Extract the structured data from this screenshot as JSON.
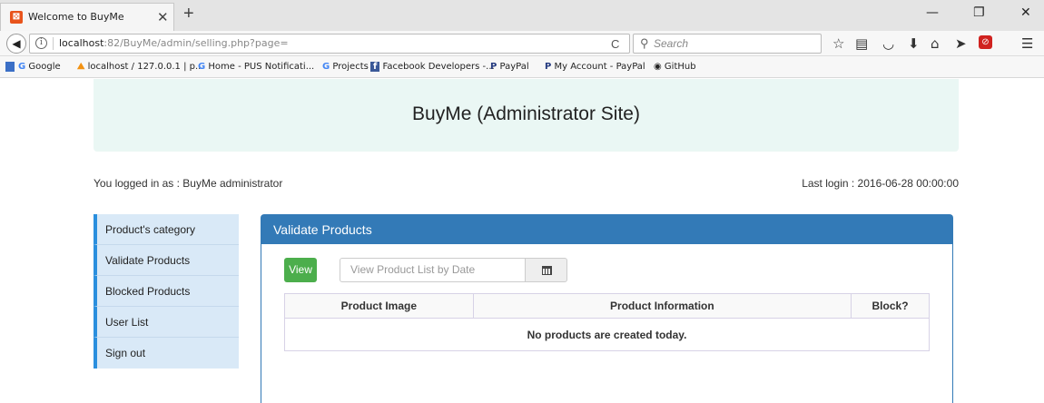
{
  "browser": {
    "tab_title": "Welcome to BuyMe",
    "tab_close": "✕",
    "new_tab": "+",
    "url_host": "localhost",
    "url_rest": ":82/BuyMe/admin/selling.php?page=",
    "search_placeholder": "Search",
    "window_controls": {
      "minimize": "—",
      "maximize": "❐",
      "close": "✕"
    },
    "bookmarks": [
      {
        "icon": "G",
        "label": "Google"
      },
      {
        "icon": "⛰",
        "label": "localhost / 127.0.0.1 | p..."
      },
      {
        "icon": "G",
        "label": "Home - PUS Notificati..."
      },
      {
        "icon": "G",
        "label": "Projects"
      },
      {
        "icon": "f",
        "label": "Facebook Developers -..."
      },
      {
        "icon": "P",
        "label": "PayPal"
      },
      {
        "icon": "P",
        "label": "My Account - PayPal"
      },
      {
        "icon": "◉",
        "label": "GitHub"
      }
    ]
  },
  "header": {
    "title": "BuyMe (Administrator Site)",
    "logged_in_as": "You logged in as : BuyMe administrator",
    "last_login": "Last login : 2016-06-28 00:00:00"
  },
  "sidebar": {
    "items": [
      {
        "label": "Product's category"
      },
      {
        "label": "Validate Products"
      },
      {
        "label": "Blocked Products"
      },
      {
        "label": "User List"
      },
      {
        "label": "Sign out"
      }
    ]
  },
  "panel": {
    "heading": "Validate Products",
    "view_label": "View",
    "date_placeholder": "View Product List by Date",
    "table": {
      "columns": [
        "Product Image",
        "Product Information",
        "Block?"
      ],
      "empty_message": "No products are created today."
    }
  }
}
